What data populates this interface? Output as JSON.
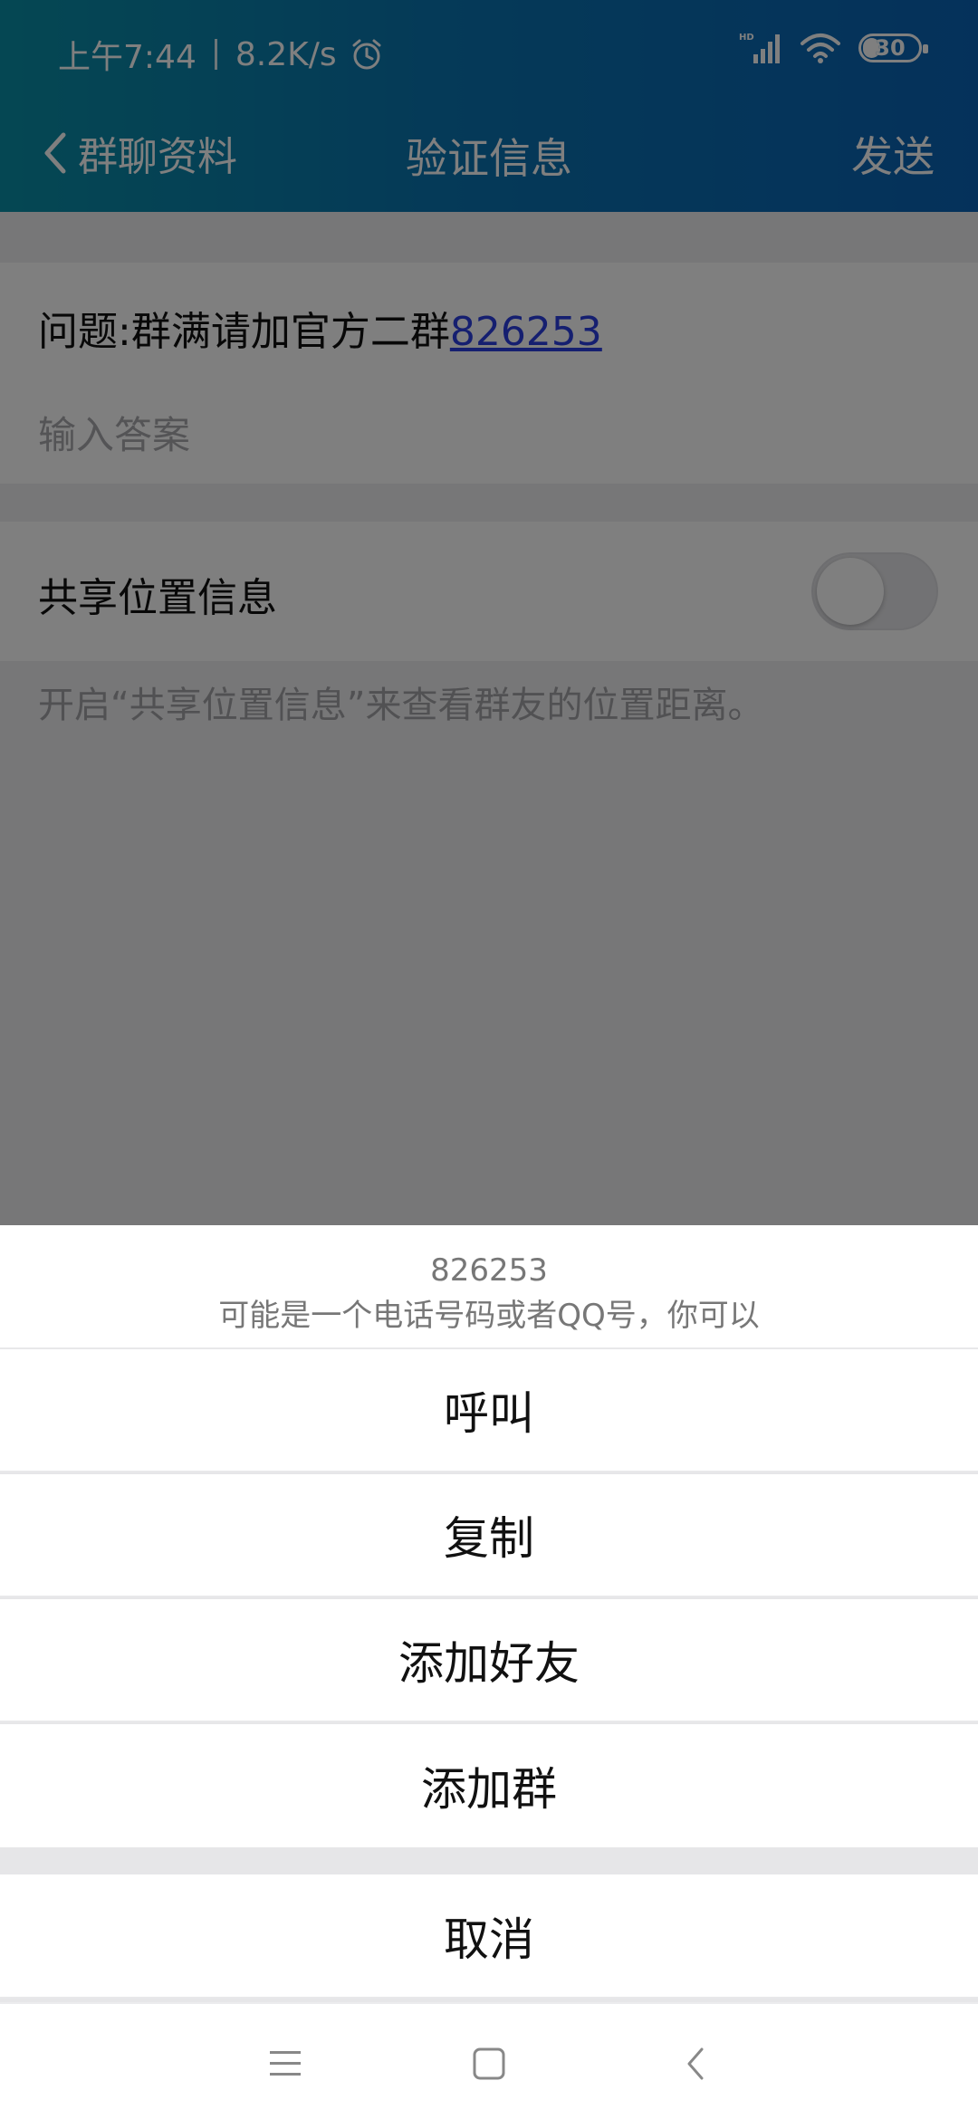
{
  "status_bar": {
    "time": "上午7:44",
    "net_speed": "8.2K/s",
    "battery": "30",
    "signal_label": "HD"
  },
  "nav": {
    "back_label": "群聊资料",
    "title": "验证信息",
    "send_label": "发送"
  },
  "form": {
    "question_prefix": "问题:群满请加官方二群",
    "question_link": "826253",
    "answer_placeholder": "输入答案",
    "answer_value": "",
    "share_location_label": "共享位置信息",
    "share_location_on": false,
    "share_location_hint": "开启“共享位置信息”来查看群友的位置距离。"
  },
  "action_sheet": {
    "number": "826253",
    "description": "可能是一个电话号码或者QQ号，你可以",
    "items": [
      {
        "label": "呼叫"
      },
      {
        "label": "复制"
      },
      {
        "label": "添加好友"
      },
      {
        "label": "添加群"
      }
    ],
    "cancel_label": "取消"
  },
  "colors": {
    "header_start": "#0b8fa6",
    "header_end": "#0a63b6",
    "link": "#2b3ee0"
  },
  "icons": {
    "back": "chevron-left-icon",
    "alarm": "alarm-clock-icon",
    "signal": "signal-icon",
    "wifi": "wifi-icon",
    "menu": "menu-icon",
    "home": "home-icon",
    "sys_back": "back-icon"
  }
}
